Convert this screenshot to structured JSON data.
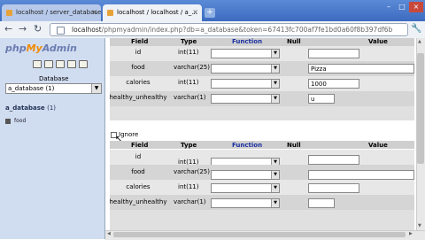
{
  "tabs": [
    {
      "label": "localhost / server_database...",
      "active": false
    },
    {
      "label": "localhost / localhost / a_...",
      "active": true
    }
  ],
  "address_bar": {
    "host": "localhost",
    "path": "/phpmyadmin/index.php?db=a_database&token=67413fc700af7fe1bd0a60f8b397df6b"
  },
  "sidebar": {
    "logo_php": "php",
    "logo_my": "My",
    "logo_admin": "Admin",
    "db_label": "Database",
    "db_selected": "a_database (1)",
    "db_name": "a_database",
    "db_count": "(1)",
    "tables": [
      "food"
    ]
  },
  "headers": {
    "field": "Field",
    "type": "Type",
    "function": "Function",
    "null": "Null",
    "value": "Value"
  },
  "block1": {
    "rows": [
      {
        "field": "id",
        "type": "int(11)",
        "value": ""
      },
      {
        "field": "food",
        "type": "varchar(25)",
        "value": "Pizza"
      },
      {
        "field": "calories",
        "type": "int(11)",
        "value": "1000"
      },
      {
        "field": "healthy_unhealthy",
        "type": "varchar(1)",
        "value": "u"
      }
    ]
  },
  "ignore_label": "Ignore",
  "block2": {
    "rows": [
      {
        "field": "id",
        "type": "int(11)",
        "value": ""
      },
      {
        "field": "food",
        "type": "varchar(25)",
        "value": ""
      },
      {
        "field": "calories",
        "type": "int(11)",
        "value": ""
      },
      {
        "field": "healthy_unhealthy",
        "type": "varchar(1)",
        "value": ""
      }
    ]
  }
}
